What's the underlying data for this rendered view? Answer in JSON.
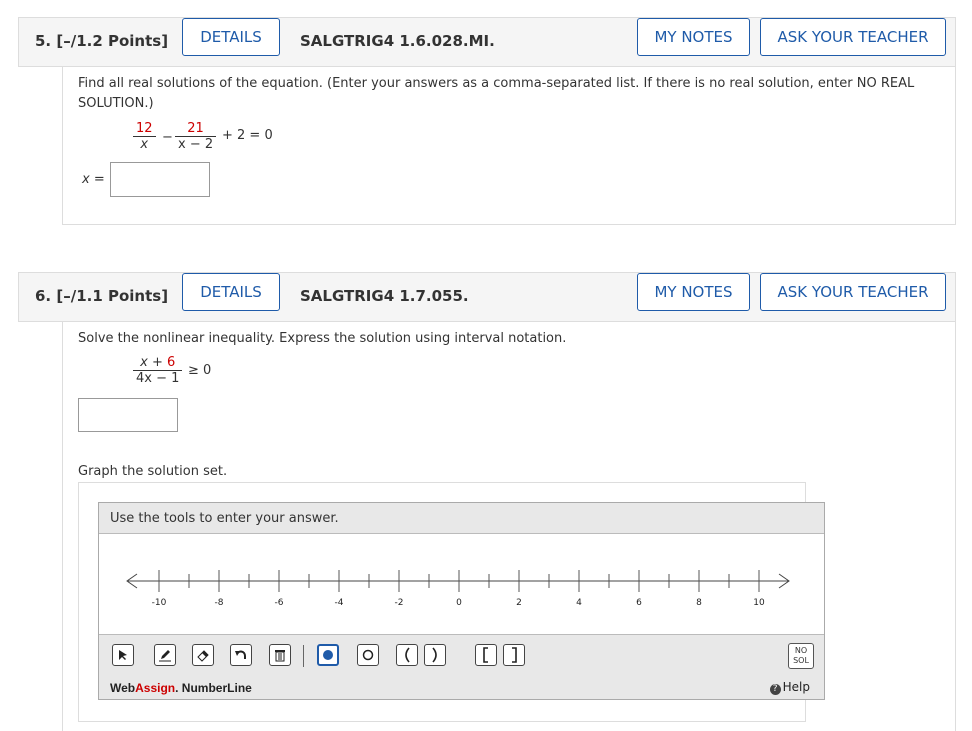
{
  "q5": {
    "number": "5. [–/1.2 Points]",
    "details": "DETAILS",
    "code": "SALGTRIG4 1.6.028.MI.",
    "my_notes": "MY NOTES",
    "ask_teacher": "ASK YOUR TEACHER",
    "prompt": "Find all real solutions of the equation. (Enter your answers as a comma-separated list. If there is no real solution, enter NO REAL SOLUTION.)",
    "eq": {
      "n1": "12",
      "d1": "x",
      "minus": "−",
      "n2": "21",
      "d2": "x − 2",
      "rest": "+ 2 = 0"
    },
    "answer_label": "x ="
  },
  "q6": {
    "number": "6. [–/1.1 Points]",
    "details": "DETAILS",
    "code": "SALGTRIG4 1.7.055.",
    "my_notes": "MY NOTES",
    "ask_teacher": "ASK YOUR TEACHER",
    "prompt": "Solve the nonlinear inequality. Express the solution using interval notation.",
    "ineq": {
      "num_a": "x + ",
      "num_b": "6",
      "den": "4x − 1",
      "rel": "≥ 0"
    },
    "graph_prompt": "Graph the solution set.",
    "numberline": {
      "instruction": "Use the tools to enter your answer.",
      "ticks": [
        "-10",
        "-8",
        "-6",
        "-4",
        "-2",
        "0",
        "2",
        "4",
        "6",
        "8",
        "10"
      ],
      "brand_a": "Web",
      "brand_b": "Assign",
      "brand_c": ". NumberLine",
      "no_sol_1": "NO",
      "no_sol_2": "SOL",
      "help": "Help",
      "tools": [
        "pointer-icon",
        "pencil-icon",
        "eraser-icon",
        "undo-icon",
        "trash-icon",
        "closed-dot-icon",
        "open-dot-icon",
        "left-paren-icon",
        "right-paren-icon",
        "left-bracket-icon",
        "right-bracket-icon"
      ]
    }
  }
}
